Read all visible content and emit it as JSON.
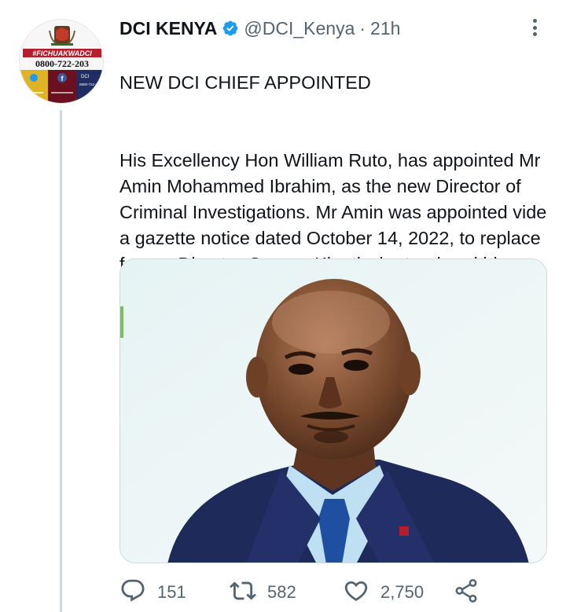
{
  "tweet": {
    "display_name": "DCI KENYA",
    "handle": "@DCI_Kenya",
    "separator": "·",
    "time": "21h",
    "title": "NEW DCI CHIEF APPOINTED",
    "body": "His Excellency Hon William Ruto, has appointed Mr Amin Mohammed Ibrahim, as the new Director of Criminal Investigations. Mr Amin was appointed vide a gazette notice dated October 14, 2022, to replace former Director George Kinoti who tendered his"
  },
  "avatar": {
    "hashtag": "#FICHUAKWADCI",
    "hotline": "0800-722-203",
    "badge_text": "DCI",
    "badge_sub": "0800-722-203"
  },
  "actions": {
    "replies": "151",
    "retweets": "582",
    "likes": "2,750"
  },
  "colors": {
    "verified": "#1d9bf0",
    "muted": "#536471",
    "avatar_red": "#b51e2a",
    "avatar_yellow": "#e0b325",
    "avatar_maroon": "#6b1020",
    "avatar_navy": "#1f2d63",
    "suit_navy": "#1e2a5a"
  },
  "icons": [
    "verified-badge-icon",
    "more-options-icon",
    "reply-icon",
    "retweet-icon",
    "like-icon",
    "share-icon"
  ]
}
